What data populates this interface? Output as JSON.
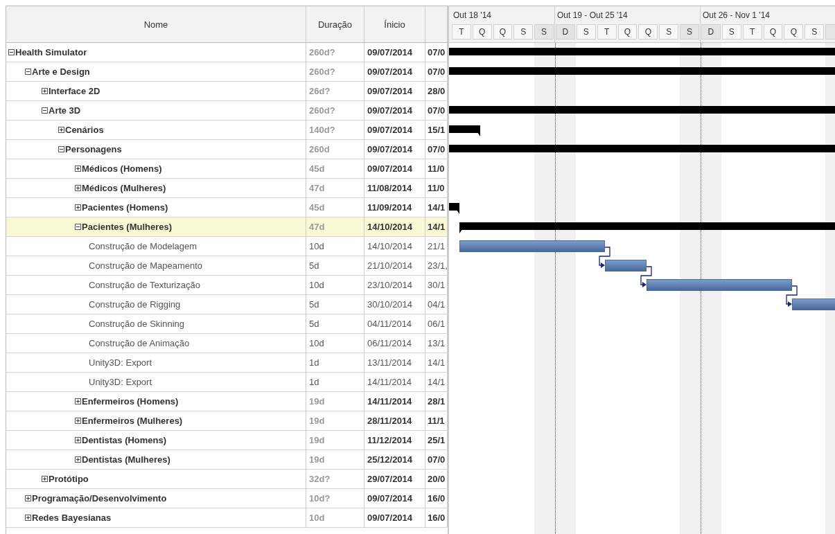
{
  "columns": [
    {
      "label": "Nome"
    },
    {
      "label": "Duração"
    },
    {
      "label": "Ínicio"
    }
  ],
  "timeline": {
    "weeks": [
      {
        "label": "Out 18 '14",
        "days": [
          {
            "label": "T",
            "weekend": false
          },
          {
            "label": "Q",
            "weekend": false
          },
          {
            "label": "Q",
            "weekend": false
          },
          {
            "label": "S",
            "weekend": false
          },
          {
            "label": "S",
            "weekend": true
          }
        ]
      },
      {
        "label": "Out 19 - Out 25 '14",
        "days": [
          {
            "label": "D",
            "weekend": true
          },
          {
            "label": "S",
            "weekend": false
          },
          {
            "label": "T",
            "weekend": false
          },
          {
            "label": "Q",
            "weekend": false
          },
          {
            "label": "Q",
            "weekend": false
          },
          {
            "label": "S",
            "weekend": false
          },
          {
            "label": "S",
            "weekend": true
          }
        ]
      },
      {
        "label": "Out 26 - Nov 1 '14",
        "days": [
          {
            "label": "D",
            "weekend": true
          },
          {
            "label": "S",
            "weekend": false
          },
          {
            "label": "T",
            "weekend": false
          },
          {
            "label": "Q",
            "weekend": false
          },
          {
            "label": "Q",
            "weekend": false
          },
          {
            "label": "S",
            "weekend": false
          },
          {
            "weekend": true
          }
        ]
      }
    ]
  },
  "tasks": [
    {
      "kind": "summary",
      "name": "Health Simulator",
      "duration": "260d?",
      "start": "09/07/2014",
      "finish": "07/0",
      "expanded": true,
      "selected": false,
      "bar": {
        "kind": "summary",
        "continues": true
      },
      "children": [
        {
          "kind": "summary",
          "name": "Arte e Design",
          "duration": "260d?",
          "start": "09/07/2014",
          "finish": "07/0",
          "expanded": true,
          "selected": false,
          "bar": {
            "kind": "summary",
            "continues": true
          },
          "children": [
            {
              "kind": "summary",
              "name": "Interface 2D",
              "duration": "26d?",
              "start": "09/07/2014",
              "finish": "28/0",
              "expanded": false,
              "selected": false
            },
            {
              "kind": "summary",
              "name": "Arte 3D",
              "duration": "260d?",
              "start": "09/07/2014",
              "finish": "07/0",
              "expanded": true,
              "selected": false,
              "bar": {
                "kind": "summary",
                "continues": true
              },
              "children": [
                {
                  "kind": "summary",
                  "name": "Cenários",
                  "duration": "140d?",
                  "start": "09/07/2014",
                  "finish": "15/1",
                  "expanded": false,
                  "selected": false,
                  "bar": {
                    "kind": "summary",
                    "continues": false
                  }
                },
                {
                  "kind": "summary",
                  "name": "Personagens",
                  "duration": "260d",
                  "start": "09/07/2014",
                  "finish": "07/0",
                  "expanded": true,
                  "selected": false,
                  "bar": {
                    "kind": "summary",
                    "continues": true
                  },
                  "children": [
                    {
                      "kind": "summary",
                      "name": "Médicos (Homens)",
                      "duration": "45d",
                      "start": "09/07/2014",
                      "finish": "11/0",
                      "expanded": false,
                      "selected": false
                    },
                    {
                      "kind": "summary",
                      "name": "Médicos (Mulheres)",
                      "duration": "47d",
                      "start": "11/08/2014",
                      "finish": "11/0",
                      "expanded": false,
                      "selected": false
                    },
                    {
                      "kind": "summary",
                      "name": "Pacientes (Homens)",
                      "duration": "45d",
                      "start": "11/09/2014",
                      "finish": "14/1",
                      "expanded": false,
                      "selected": false,
                      "bar": {
                        "kind": "summary",
                        "continues": false
                      }
                    },
                    {
                      "kind": "summary",
                      "name": "Pacientes (Mulheres)",
                      "duration": "47d",
                      "start": "14/10/2014",
                      "finish": "14/1",
                      "expanded": true,
                      "selected": true,
                      "bar": {
                        "kind": "summary",
                        "continues": true
                      },
                      "children": [
                        {
                          "kind": "task",
                          "name": "Construção de Modelagem",
                          "duration": "10d",
                          "start": "14/10/2014",
                          "finish": "21/1",
                          "selected": false,
                          "bar": {
                            "kind": "task",
                            "continues": false
                          }
                        },
                        {
                          "kind": "task",
                          "name": "Construção de Mapeamento",
                          "duration": "5d",
                          "start": "21/10/2014",
                          "finish": "23/1,",
                          "selected": false,
                          "bar": {
                            "kind": "task",
                            "continues": false,
                            "linked": true
                          }
                        },
                        {
                          "kind": "task",
                          "name": "Construção de Texturização",
                          "duration": "10d",
                          "start": "23/10/2014",
                          "finish": "30/1",
                          "selected": false,
                          "bar": {
                            "kind": "task",
                            "continues": false,
                            "linked": true
                          }
                        },
                        {
                          "kind": "task",
                          "name": "Construção de Rigging",
                          "duration": "5d",
                          "start": "30/10/2014",
                          "finish": "04/1",
                          "selected": false,
                          "bar": {
                            "kind": "task",
                            "continues": true,
                            "linked": true
                          }
                        },
                        {
                          "kind": "task",
                          "name": "Construção de Skinning",
                          "duration": "5d",
                          "start": "04/11/2014",
                          "finish": "06/1",
                          "selected": false
                        },
                        {
                          "kind": "task",
                          "name": "Construção de Animação",
                          "duration": "10d",
                          "start": "06/11/2014",
                          "finish": "13/1",
                          "selected": false
                        },
                        {
                          "kind": "task",
                          "name": "Unity3D: Export",
                          "duration": "1d",
                          "start": "13/11/2014",
                          "finish": "14/1",
                          "selected": false
                        },
                        {
                          "kind": "task",
                          "name": "Unity3D: Export",
                          "duration": "1d",
                          "start": "14/11/2014",
                          "finish": "14/1",
                          "selected": false
                        }
                      ]
                    },
                    {
                      "kind": "summary",
                      "name": "Enfermeiros (Homens)",
                      "duration": "19d",
                      "start": "14/11/2014",
                      "finish": "28/1",
                      "expanded": false,
                      "selected": false
                    },
                    {
                      "kind": "summary",
                      "name": "Enfermeiros (Mulheres)",
                      "duration": "19d",
                      "start": "28/11/2014",
                      "finish": "11/1",
                      "expanded": false,
                      "selected": false
                    },
                    {
                      "kind": "summary",
                      "name": "Dentistas (Homens)",
                      "duration": "19d",
                      "start": "11/12/2014",
                      "finish": "25/1",
                      "expanded": false,
                      "selected": false
                    },
                    {
                      "kind": "summary",
                      "name": "Dentistas (Mulheres)",
                      "duration": "19d",
                      "start": "25/12/2014",
                      "finish": "07/0",
                      "expanded": false,
                      "selected": false
                    }
                  ]
                }
              ]
            },
            {
              "kind": "summary",
              "name": "Protótipo",
              "duration": "32d?",
              "start": "29/07/2014",
              "finish": "20/0",
              "expanded": false,
              "selected": false
            }
          ]
        },
        {
          "kind": "summary",
          "name": "Programação/Desenvolvimento",
          "duration": "10d?",
          "start": "09/07/2014",
          "finish": "16/0",
          "expanded": false,
          "selected": false
        },
        {
          "kind": "summary",
          "name": "Redes Bayesianas",
          "duration": "10d",
          "start": "09/07/2014",
          "finish": "16/0",
          "expanded": false,
          "selected": false
        }
      ]
    }
  ]
}
